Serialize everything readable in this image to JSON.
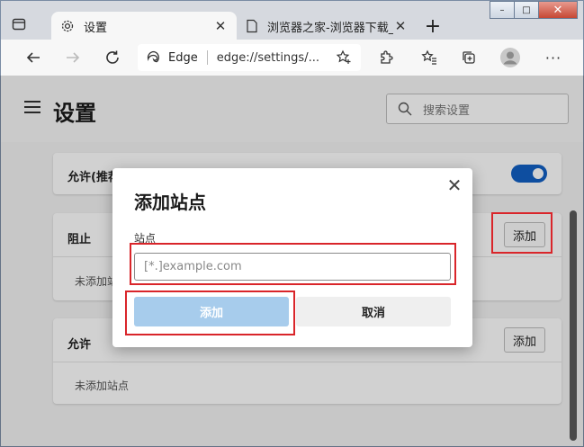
{
  "browser": {
    "tabs": [
      {
        "title": "设置",
        "active": true
      },
      {
        "title": "浏览器之家-浏览器下载_浏",
        "active": false
      }
    ],
    "address": {
      "site_label": "Edge",
      "url": "edge://settings/..."
    },
    "window_controls": {
      "minimize": "–",
      "maximize": "□",
      "close": "✕"
    }
  },
  "settings": {
    "title": "设置",
    "search_placeholder": "搜索设置",
    "sections": {
      "allow_top": {
        "label": "允许(推荐)",
        "toggle_on": true
      },
      "block": {
        "label": "阻止",
        "add_label": "添加",
        "empty_text": "未添加站点"
      },
      "allow": {
        "label": "允许",
        "add_label": "添加",
        "empty_text": "未添加站点"
      }
    }
  },
  "dialog": {
    "title": "添加站点",
    "field_label": "站点",
    "input_value": "",
    "input_placeholder": "[*.]example.com",
    "primary_label": "添加",
    "secondary_label": "取消"
  },
  "colors": {
    "accent": "#1260c4",
    "primary_disabled": "#a7ccec",
    "highlight": "#d9252a"
  }
}
